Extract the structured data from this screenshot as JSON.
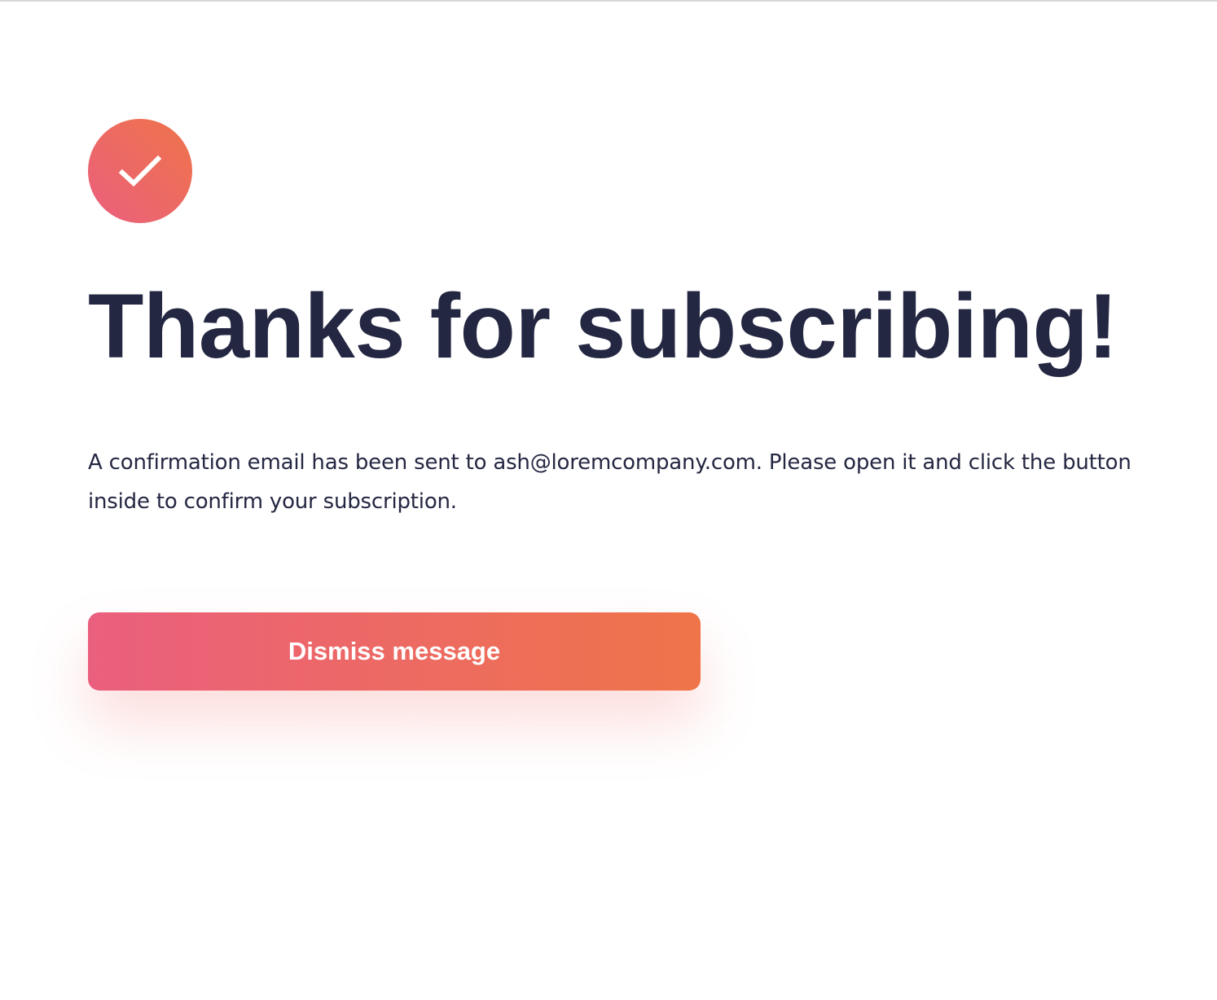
{
  "page": {
    "icon": "checkmark-icon",
    "title": "Thanks for subscribing!",
    "message": "A confirmation email has been sent to ash@loremcompany.com. Please open it and click the button inside to confirm your subscription.",
    "dismiss_label": "Dismiss message"
  },
  "colors": {
    "text": "#242742",
    "gradient_start": "#ea5f7e",
    "gradient_end": "#ef7449",
    "button_text": "#ffffff",
    "background": "#ffffff"
  }
}
